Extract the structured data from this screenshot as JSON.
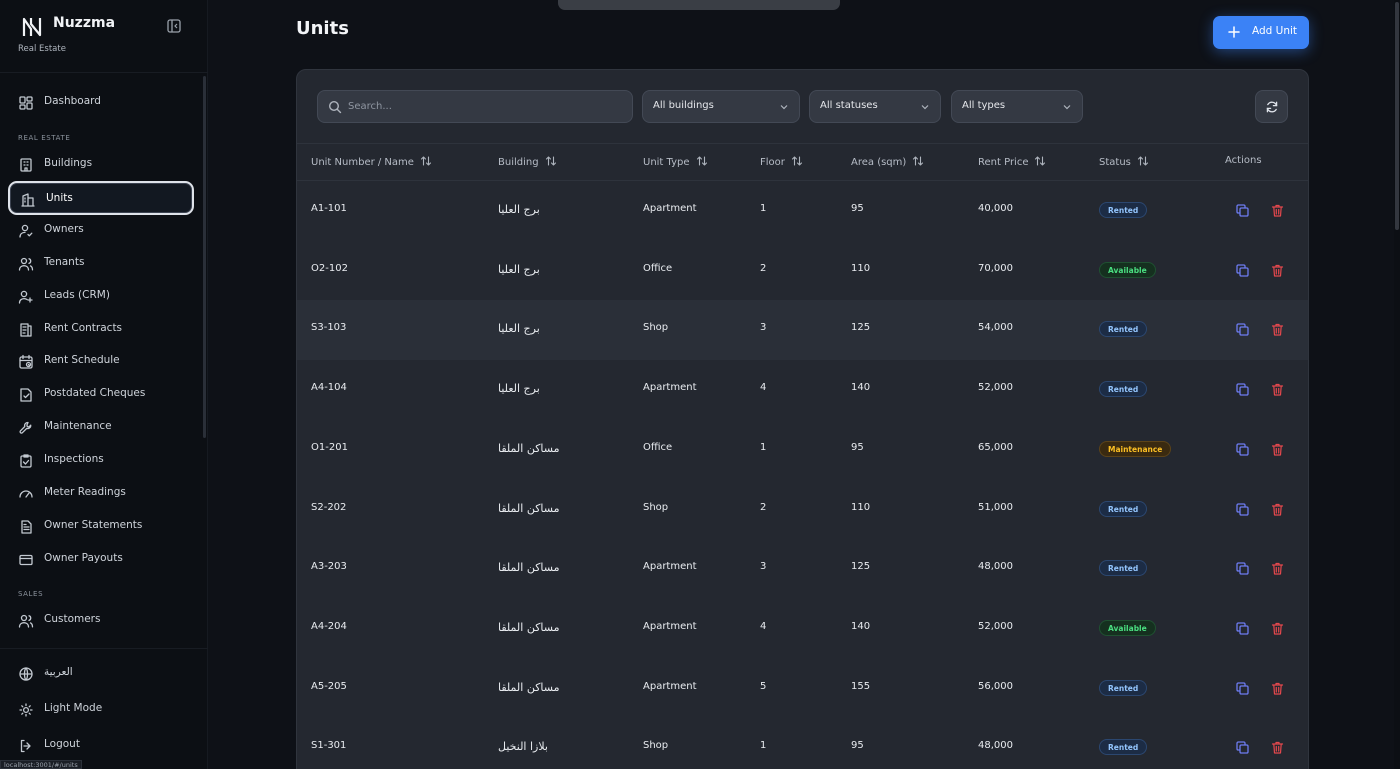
{
  "app": {
    "name": "Nuzzma",
    "subtitle": "Real Estate"
  },
  "nav": {
    "top": [
      {
        "key": "dashboard",
        "label": "Dashboard",
        "icon": "dashboard-icon"
      }
    ],
    "real_estate_label": "REAL ESTATE",
    "real_estate": [
      {
        "key": "buildings",
        "label": "Buildings",
        "icon": "building-icon"
      },
      {
        "key": "units",
        "label": "Units",
        "icon": "units-icon",
        "active": true
      },
      {
        "key": "owners",
        "label": "Owners",
        "icon": "owner-icon"
      },
      {
        "key": "tenants",
        "label": "Tenants",
        "icon": "users-icon"
      },
      {
        "key": "leads",
        "label": "Leads (CRM)",
        "icon": "user-plus-icon"
      },
      {
        "key": "rent-contracts",
        "label": "Rent Contracts",
        "icon": "contract-icon"
      },
      {
        "key": "rent-schedule",
        "label": "Rent Schedule",
        "icon": "calendar-icon"
      },
      {
        "key": "postdated-cheques",
        "label": "Postdated Cheques",
        "icon": "cheque-icon"
      },
      {
        "key": "maintenance",
        "label": "Maintenance",
        "icon": "wrench-icon"
      },
      {
        "key": "inspections",
        "label": "Inspections",
        "icon": "clipboard-check-icon"
      },
      {
        "key": "meter-readings",
        "label": "Meter Readings",
        "icon": "gauge-icon"
      },
      {
        "key": "owner-statements",
        "label": "Owner Statements",
        "icon": "document-icon"
      },
      {
        "key": "owner-payouts",
        "label": "Owner Payouts",
        "icon": "card-icon"
      }
    ],
    "sales_label": "SALES",
    "sales": [
      {
        "key": "customers",
        "label": "Customers",
        "icon": "users-icon"
      }
    ],
    "bottom": [
      {
        "key": "language",
        "label": "العربية",
        "icon": "globe-icon"
      },
      {
        "key": "theme",
        "label": "Light Mode",
        "icon": "sun-icon"
      },
      {
        "key": "logout",
        "label": "Logout",
        "icon": "logout-icon"
      }
    ],
    "status_url": "localhost:3001/#/units"
  },
  "page": {
    "title": "Units",
    "add_label": "Add Unit"
  },
  "filters": {
    "search_placeholder": "Search...",
    "buildings": "All buildings",
    "statuses": "All statuses",
    "types": "All types"
  },
  "table": {
    "columns": [
      "Unit Number / Name",
      "Building",
      "Unit Type",
      "Floor",
      "Area (sqm)",
      "Rent Price",
      "Status",
      "Actions"
    ],
    "rows": [
      {
        "unit": "A1-101",
        "building": "برج العليا",
        "type": "Apartment",
        "floor": "1",
        "area": "95",
        "rent": "40,000",
        "status": "Rented",
        "status_key": "rented"
      },
      {
        "unit": "O2-102",
        "building": "برج العليا",
        "type": "Office",
        "floor": "2",
        "area": "110",
        "rent": "70,000",
        "status": "Available",
        "status_key": "available"
      },
      {
        "unit": "S3-103",
        "building": "برج العليا",
        "type": "Shop",
        "floor": "3",
        "area": "125",
        "rent": "54,000",
        "status": "Rented",
        "status_key": "rented"
      },
      {
        "unit": "A4-104",
        "building": "برج العليا",
        "type": "Apartment",
        "floor": "4",
        "area": "140",
        "rent": "52,000",
        "status": "Rented",
        "status_key": "rented"
      },
      {
        "unit": "O1-201",
        "building": "مساكن الملقا",
        "type": "Office",
        "floor": "1",
        "area": "95",
        "rent": "65,000",
        "status": "Maintenance",
        "status_key": "maintenance"
      },
      {
        "unit": "S2-202",
        "building": "مساكن الملقا",
        "type": "Shop",
        "floor": "2",
        "area": "110",
        "rent": "51,000",
        "status": "Rented",
        "status_key": "rented"
      },
      {
        "unit": "A3-203",
        "building": "مساكن الملقا",
        "type": "Apartment",
        "floor": "3",
        "area": "125",
        "rent": "48,000",
        "status": "Rented",
        "status_key": "rented"
      },
      {
        "unit": "A4-204",
        "building": "مساكن الملقا",
        "type": "Apartment",
        "floor": "4",
        "area": "140",
        "rent": "52,000",
        "status": "Available",
        "status_key": "available"
      },
      {
        "unit": "A5-205",
        "building": "مساكن الملقا",
        "type": "Apartment",
        "floor": "5",
        "area": "155",
        "rent": "56,000",
        "status": "Rented",
        "status_key": "rented"
      },
      {
        "unit": "S1-301",
        "building": "بلازا النخيل",
        "type": "Shop",
        "floor": "1",
        "area": "95",
        "rent": "48,000",
        "status": "Rented",
        "status_key": "rented"
      }
    ]
  },
  "colors": {
    "accent": "#3b82f6",
    "danger": "#ef4444",
    "copy": "#6d7cf0"
  }
}
